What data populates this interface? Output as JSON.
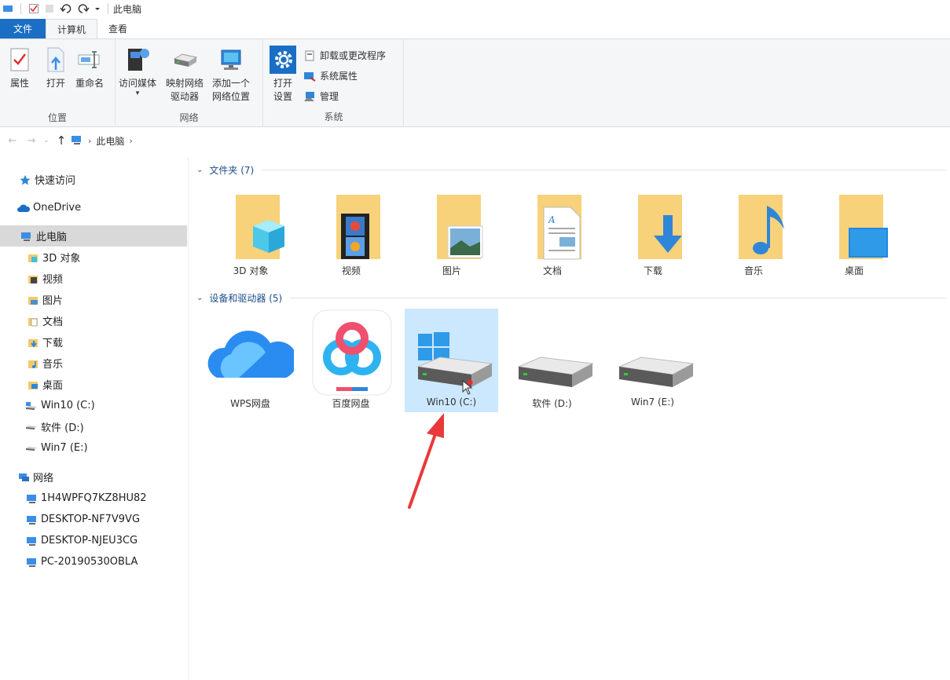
{
  "titlebar": {
    "title": "此电脑"
  },
  "tabs": [
    {
      "label": "文件"
    },
    {
      "label": "计算机"
    },
    {
      "label": "查看"
    }
  ],
  "ribbon": {
    "location": {
      "label": "位置",
      "buttons": [
        {
          "label": "属性"
        },
        {
          "label": "打开"
        },
        {
          "label": "重命名"
        }
      ]
    },
    "network": {
      "label": "网络",
      "buttons": [
        {
          "line1": "访问媒体",
          "line2": ""
        },
        {
          "line1": "映射网络",
          "line2": "驱动器"
        },
        {
          "line1": "添加一个",
          "line2": "网络位置"
        }
      ]
    },
    "system": {
      "label": "系统",
      "open_settings": {
        "line1": "打开",
        "line2": "设置"
      },
      "small_buttons": [
        {
          "label": "卸载或更改程序"
        },
        {
          "label": "系统属性"
        },
        {
          "label": "管理"
        }
      ]
    }
  },
  "address": {
    "crumbs": [
      "此电脑"
    ]
  },
  "sidebar": {
    "items": [
      {
        "label": "快速访问",
        "icon": "star-icon"
      },
      {
        "label": "OneDrive",
        "icon": "cloud-icon"
      },
      {
        "label": "此电脑",
        "icon": "computer-icon"
      },
      {
        "label": "3D 对象",
        "icon": "3d-objects-icon"
      },
      {
        "label": "视频",
        "icon": "video-icon"
      },
      {
        "label": "图片",
        "icon": "pictures-icon"
      },
      {
        "label": "文档",
        "icon": "documents-icon"
      },
      {
        "label": "下载",
        "icon": "downloads-icon"
      },
      {
        "label": "音乐",
        "icon": "music-icon"
      },
      {
        "label": "桌面",
        "icon": "desktop-icon"
      },
      {
        "label": "Win10 (C:)",
        "icon": "system-drive-icon"
      },
      {
        "label": "软件 (D:)",
        "icon": "drive-icon"
      },
      {
        "label": "Win7 (E:)",
        "icon": "drive-icon"
      },
      {
        "label": "网络",
        "icon": "network-icon"
      },
      {
        "label": "1H4WPFQ7KZ8HU82",
        "icon": "pc-icon"
      },
      {
        "label": "DESKTOP-NF7V9VG",
        "icon": "pc-icon"
      },
      {
        "label": "DESKTOP-NJEU3CG",
        "icon": "pc-icon"
      },
      {
        "label": "PC-20190530OBLA",
        "icon": "pc-icon"
      }
    ]
  },
  "folders_section": {
    "title": "文件夹 (7)",
    "items": [
      {
        "label": "3D 对象",
        "icon": "3d-objects-folder-icon"
      },
      {
        "label": "视频",
        "icon": "videos-folder-icon"
      },
      {
        "label": "图片",
        "icon": "pictures-folder-icon"
      },
      {
        "label": "文档",
        "icon": "documents-folder-icon"
      },
      {
        "label": "下载",
        "icon": "downloads-folder-icon"
      },
      {
        "label": "音乐",
        "icon": "music-folder-icon"
      },
      {
        "label": "桌面",
        "icon": "desktop-folder-icon"
      }
    ]
  },
  "devices_section": {
    "title": "设备和驱动器 (5)",
    "items": [
      {
        "label": "WPS网盘",
        "icon": "wps-cloud-icon"
      },
      {
        "label": "百度网盘",
        "icon": "baidu-netdisk-icon"
      },
      {
        "label": "Win10 (C:)",
        "icon": "windows-drive-icon"
      },
      {
        "label": "软件 (D:)",
        "icon": "hard-drive-icon"
      },
      {
        "label": "Win7 (E:)",
        "icon": "hard-drive-icon"
      }
    ]
  },
  "colors": {
    "accent": "#1a6fc4",
    "selection": "#cce8ff",
    "folder": "#f5c96a",
    "arrow": "#e83a3a"
  }
}
